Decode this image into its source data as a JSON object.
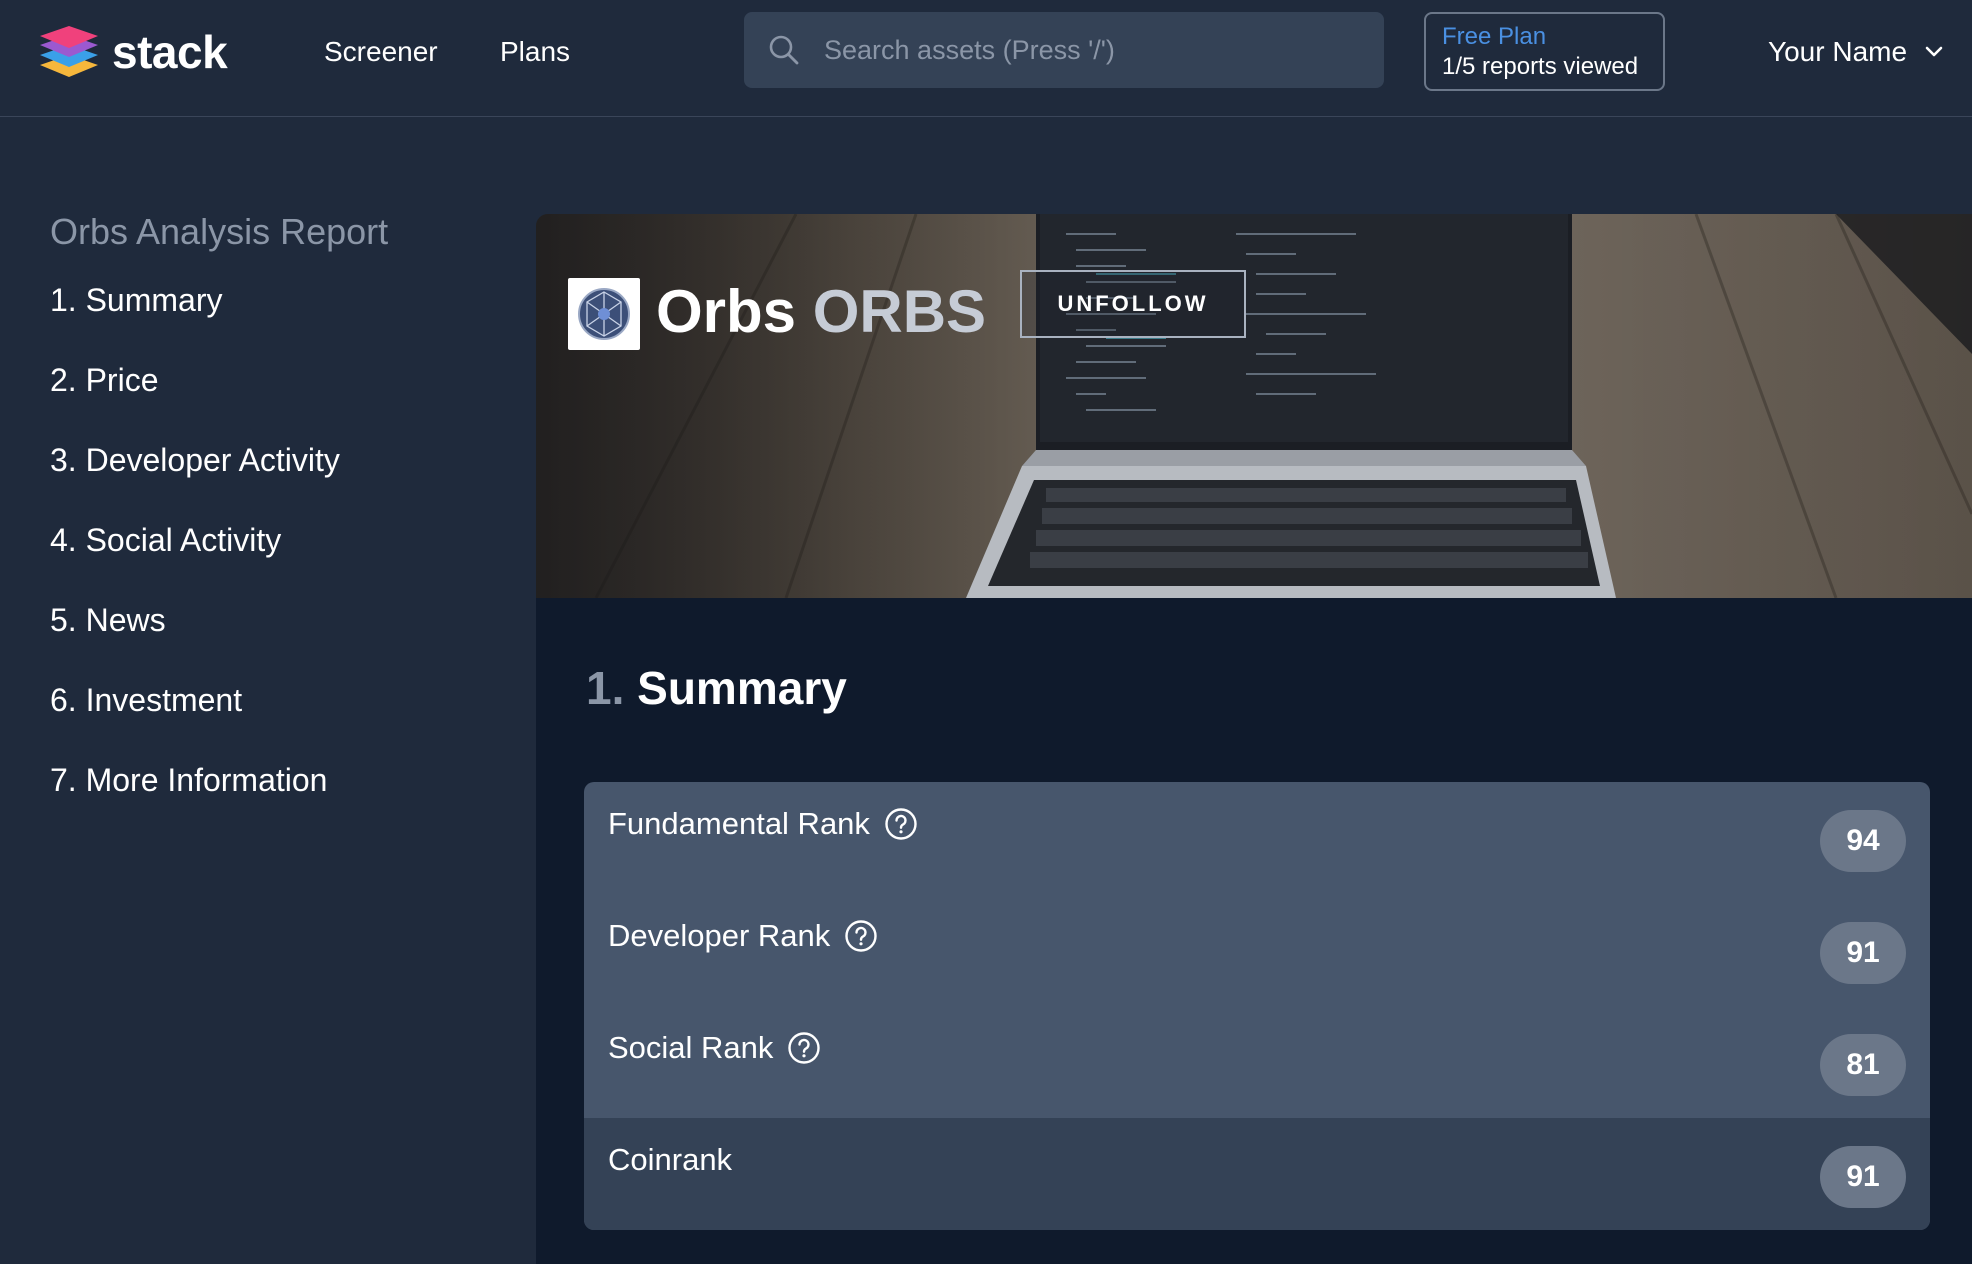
{
  "header": {
    "brand": "stack",
    "nav": [
      "Screener",
      "Plans"
    ],
    "search_placeholder": "Search assets (Press '/')",
    "plan": {
      "name": "Free Plan",
      "usage": "1/5 reports viewed"
    },
    "user_name": "Your Name"
  },
  "sidebar": {
    "title": "Orbs Analysis Report",
    "items": [
      "1. Summary",
      "2. Price",
      "3. Developer Activity",
      "4. Social Activity",
      "5. News",
      "6. Investment",
      "7. More Information"
    ]
  },
  "asset": {
    "name": "Orbs",
    "ticker": "ORBS",
    "follow_button": "UNFOLLOW"
  },
  "summary": {
    "number": "1.",
    "title": "Summary",
    "ranks": [
      {
        "label": "Fundamental Rank",
        "value": "94",
        "help": true
      },
      {
        "label": "Developer Rank",
        "value": "91",
        "help": true
      },
      {
        "label": "Social Rank",
        "value": "81",
        "help": true
      },
      {
        "label": "Coinrank",
        "value": "91",
        "help": false
      }
    ]
  },
  "icons": {
    "logo": "stack-layers-logo",
    "search": "search-icon",
    "chevron": "chevron-down-icon",
    "help": "question-circle-icon"
  },
  "colors": {
    "background": "#1f2a3c",
    "main_panel": "#0f1a2c",
    "plan_accent": "#4a90e2",
    "rank_panel": "#47566c",
    "rank_badge": "#6b7789"
  }
}
